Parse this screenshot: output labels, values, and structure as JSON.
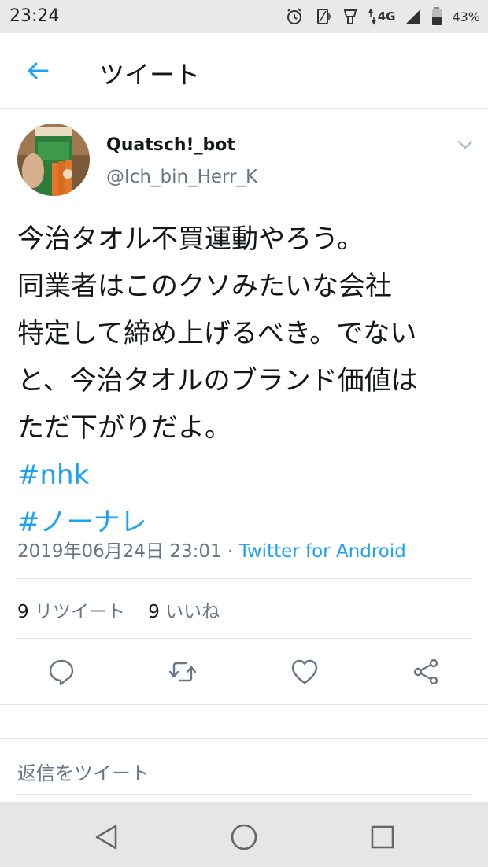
{
  "status_bar": {
    "time": "23:24",
    "network": "4G",
    "battery": "43%",
    "icons": [
      "alarm-icon",
      "vibrate-icon",
      "hotspot-icon",
      "data-arrows-icon",
      "signal-icon",
      "battery-icon"
    ]
  },
  "header": {
    "title": "ツイート",
    "back_icon": "arrow-left-icon",
    "accent_color": "#1da1f2"
  },
  "tweet": {
    "author_name": "Quatsch!_bot",
    "author_handle": "@Ich_bin_Herr_K",
    "text_lines": [
      "今治タオル不買運動やろう。",
      "同業者はこのクソみたいな会社",
      "特定して締め上げるべき。でない",
      "と、今治タオルのブランド価値は",
      "ただ下がりだよ。"
    ],
    "hashtags": [
      "#nhk",
      "#ノーナレ"
    ],
    "timestamp": "2019年06月24日 23:01",
    "separator": " · ",
    "source": "Twitter for Android",
    "retweet_count": "9",
    "retweet_label": "リツイート",
    "like_count": "9",
    "like_label": "いいね"
  },
  "actions": [
    "reply-icon",
    "retweet-icon",
    "like-icon",
    "share-icon"
  ],
  "reply_placeholder": "返信をツイート",
  "nav_bar": [
    "back-triangle-icon",
    "home-circle-icon",
    "recents-square-icon"
  ]
}
